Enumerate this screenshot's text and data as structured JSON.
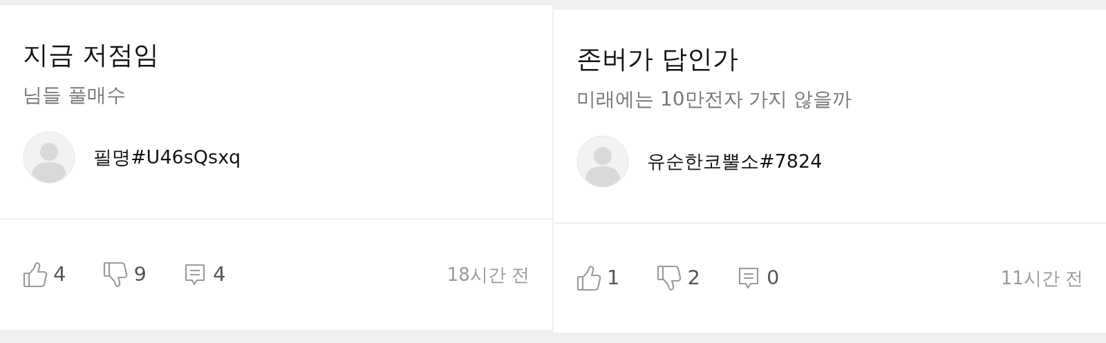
{
  "posts": [
    {
      "title": "지금 저점임",
      "body": "님들 풀매수",
      "author": "필명#U46sQsxq",
      "likes": "4",
      "dislikes": "9",
      "comments": "4",
      "time": "18시간 전"
    },
    {
      "title": "존버가 답인가",
      "body": "미래에는 10만전자 가지 않을까",
      "author": "유순한코뿔소#7824",
      "likes": "1",
      "dislikes": "2",
      "comments": "0",
      "time": "11시간 전"
    }
  ]
}
